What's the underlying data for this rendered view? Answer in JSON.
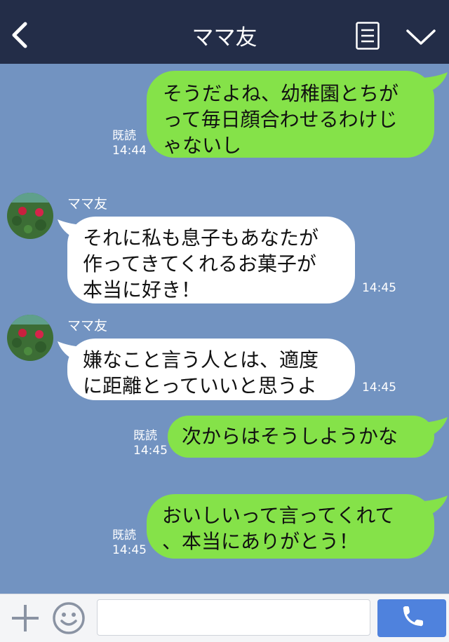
{
  "header": {
    "title": "ママ友"
  },
  "colors": {
    "header_bg": "#232d48",
    "chat_bg": "#7293c1",
    "sent_bubble": "#85e249",
    "received_bubble": "#ffffff",
    "call_button": "#4f82dd"
  },
  "icons": [
    "back-arrow-icon",
    "menu-list-icon",
    "chevron-down-icon",
    "plus-icon",
    "smiley-icon",
    "phone-icon"
  ],
  "messages": [
    {
      "side": "sent",
      "lines": [
        "そうだよね、幼稚園とちが",
        "って毎日顔合わせるわけじ",
        "ゃないし"
      ],
      "read": "既読",
      "time": "14:44"
    },
    {
      "side": "received",
      "sender": "ママ友",
      "lines": [
        "それに私も息子もあなたが",
        "作ってきてくれるお菓子が",
        "本当に好き！"
      ],
      "time": "14:45"
    },
    {
      "side": "received",
      "sender": "ママ友",
      "lines": [
        "嫌なこと言う人とは、適度",
        "に距離とっていいと思うよ"
      ],
      "time": "14:45"
    },
    {
      "side": "sent",
      "lines": [
        "次からはそうしようかな"
      ],
      "read": "既読",
      "time": "14:45"
    },
    {
      "side": "sent",
      "lines": [
        "おいしいって言ってくれて",
        "、本当にありがとう！"
      ],
      "read": "既読",
      "time": "14:45"
    }
  ],
  "footer": {
    "input_value": ""
  }
}
